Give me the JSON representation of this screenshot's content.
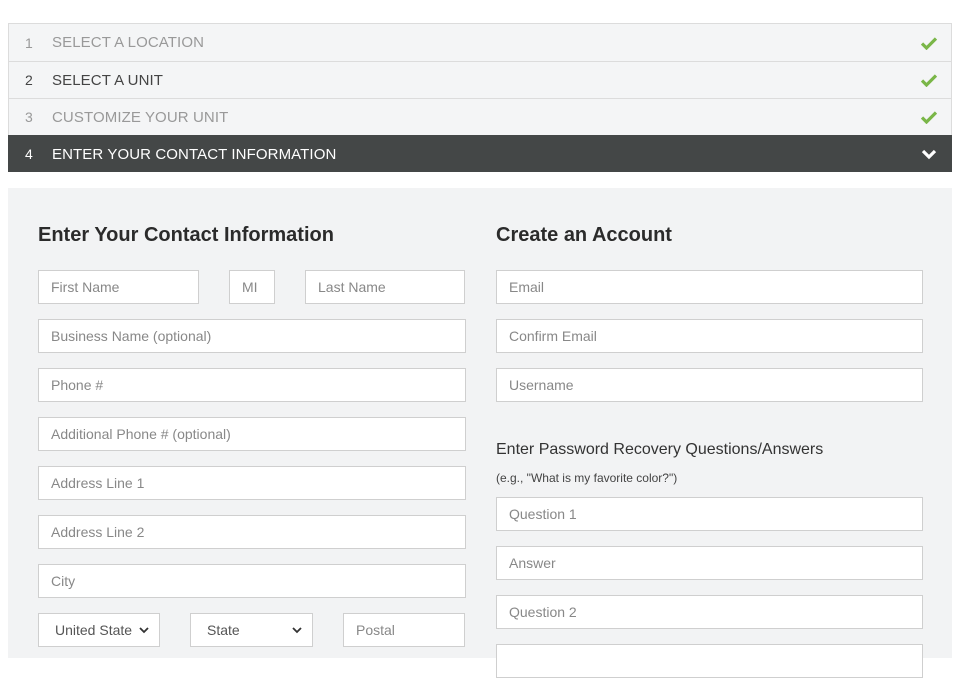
{
  "steps": [
    {
      "number": "1",
      "label": "SELECT A LOCATION",
      "status": "complete",
      "icon": "check-icon"
    },
    {
      "number": "2",
      "label": "SELECT A UNIT",
      "status": "complete",
      "icon": "check-icon"
    },
    {
      "number": "3",
      "label": "CUSTOMIZE YOUR UNIT",
      "status": "complete",
      "icon": "check-icon"
    },
    {
      "number": "4",
      "label": "ENTER YOUR CONTACT INFORMATION",
      "status": "active",
      "icon": "chevron-down-icon"
    }
  ],
  "colors": {
    "check": "#7ab648",
    "active_step_bg": "#444747",
    "panel_bg": "#f2f3f4"
  },
  "contact": {
    "title": "Enter Your Contact Information",
    "first_name": {
      "placeholder": "First Name",
      "value": ""
    },
    "mi": {
      "placeholder": "MI",
      "value": ""
    },
    "last_name": {
      "placeholder": "Last Name",
      "value": ""
    },
    "business": {
      "placeholder": "Business Name (optional)",
      "value": ""
    },
    "phone": {
      "placeholder": "Phone #",
      "value": ""
    },
    "phone2": {
      "placeholder": "Additional Phone # (optional)",
      "value": ""
    },
    "address1": {
      "placeholder": "Address Line 1",
      "value": ""
    },
    "address2": {
      "placeholder": "Address Line 2",
      "value": ""
    },
    "city": {
      "placeholder": "City",
      "value": ""
    },
    "country": {
      "selected": "United State"
    },
    "state": {
      "selected": "State"
    },
    "postal": {
      "placeholder": "Postal",
      "value": ""
    }
  },
  "account": {
    "title": "Create an Account",
    "email": {
      "placeholder": "Email",
      "value": ""
    },
    "confirm_email": {
      "placeholder": "Confirm Email",
      "value": ""
    },
    "username": {
      "placeholder": "Username",
      "value": ""
    },
    "recovery_title": "Enter Password Recovery Questions/Answers",
    "recovery_hint": "(e.g., \"What is my favorite color?\")",
    "question1": {
      "placeholder": "Question 1",
      "value": ""
    },
    "answer1": {
      "placeholder": "Answer",
      "value": ""
    },
    "question2": {
      "placeholder": "Question 2",
      "value": ""
    }
  }
}
